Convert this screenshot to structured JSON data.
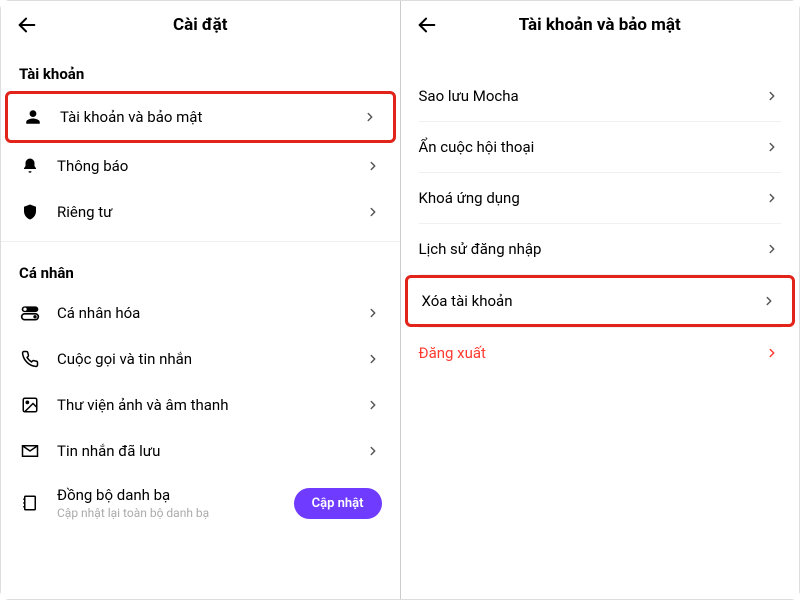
{
  "left": {
    "title": "Cài đặt",
    "sections": {
      "account_header": "Tài khoản",
      "personal_header": "Cá nhân"
    },
    "rows": {
      "account_security": "Tài khoản và bảo mật",
      "notifications": "Thông báo",
      "privacy": "Riêng tư",
      "personalize": "Cá nhân hóa",
      "calls_messages": "Cuộc gọi và tin nhắn",
      "media_library": "Thư viện ảnh và âm thanh",
      "saved_messages": "Tin nhắn đã lưu",
      "sync_contacts": "Đồng bộ danh bạ",
      "sync_contacts_sub": "Cập nhật lại toàn bộ danh bạ"
    },
    "update_btn": "Cập nhật"
  },
  "right": {
    "title": "Tài khoản và bảo mật",
    "rows": {
      "backup": "Sao lưu Mocha",
      "hide_conversation": "Ẩn cuộc hội thoại",
      "app_lock": "Khoá ứng dụng",
      "login_history": "Lịch sử đăng nhập",
      "delete_account": "Xóa tài khoản",
      "logout": "Đăng xuất"
    }
  }
}
